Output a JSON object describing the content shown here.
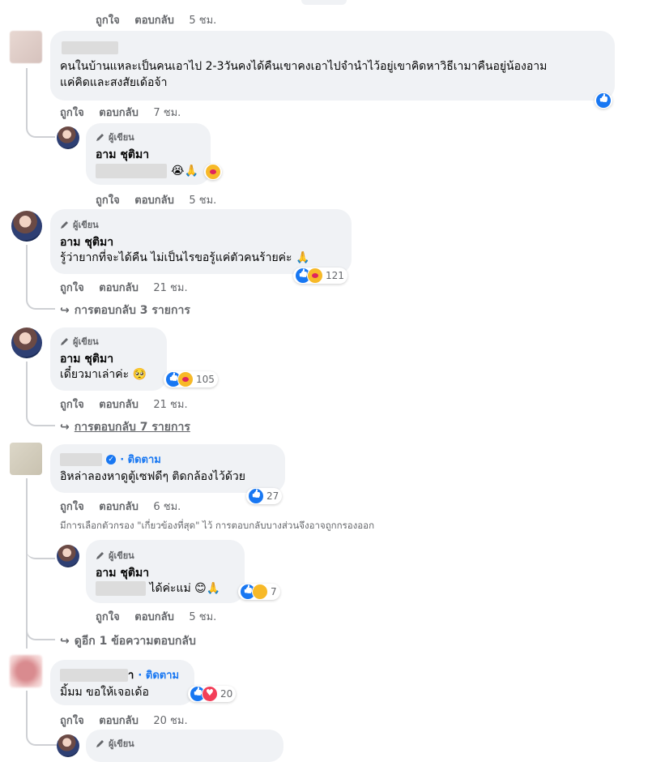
{
  "actions": {
    "like": "ถูกใจ",
    "reply": "ตอบกลับ"
  },
  "author_badge": "ผู้เขียน",
  "author_name": "อาม ชุติมา",
  "follow": "· ติดตาม",
  "colors": {
    "accent": "#1877f2",
    "bubble": "#f0f2f5",
    "meta": "#65676b"
  },
  "c0": {
    "time": "5 ชม."
  },
  "c1": {
    "text_line1": "คนในบ้านแหละเป็นคนเอาไป 2-3วันคงได้คืนเขาคงเอาไปจำนำไว้อยู่เขาคิดหาวิธีเามาคืนอยู่น้องอาม",
    "text_line2": "แค่คิดและสงสัยเด้อจ้า",
    "time": "7 ชม."
  },
  "r1": {
    "emoji": "😭🙏",
    "time": "5 ชม."
  },
  "c2": {
    "text": "รู้ว่ายากที่จะได้คืน ไม่เป็นไรขอรู้แค่ตัวคนร้ายค่ะ 🙏",
    "reactions": "121",
    "time": "21 ชม.",
    "replies": "การตอบกลับ 3 รายการ"
  },
  "c3": {
    "text": "เดี๋ยวมาเล่าค่ะ 🥺",
    "reactions": "105",
    "time": "21 ชม.",
    "replies": "การตอบกลับ 7 รายการ"
  },
  "c4": {
    "text": "อิหล่าลองหาดูตู้เซฟดีๆ ติดกล้องไว้ด้วย",
    "reactions": "27",
    "time": "6 ชม.",
    "filter_note": "มีการเลือกตัวกรอง \"เกี่ยวข้องที่สุด\" ไว้ การตอบกลับบางส่วนจึงอาจถูกกรองออก"
  },
  "r4": {
    "text": "ได้ค่ะแม่ 😊🙏",
    "reactions": "7",
    "time": "5 ชม.",
    "more": "ดูอีก 1 ข้อความตอบกลับ"
  },
  "c5": {
    "name_suffix": "า",
    "text": "มิ้มม ขอให้เจอเด้อ",
    "reactions": "20",
    "time": "20 ชม."
  }
}
